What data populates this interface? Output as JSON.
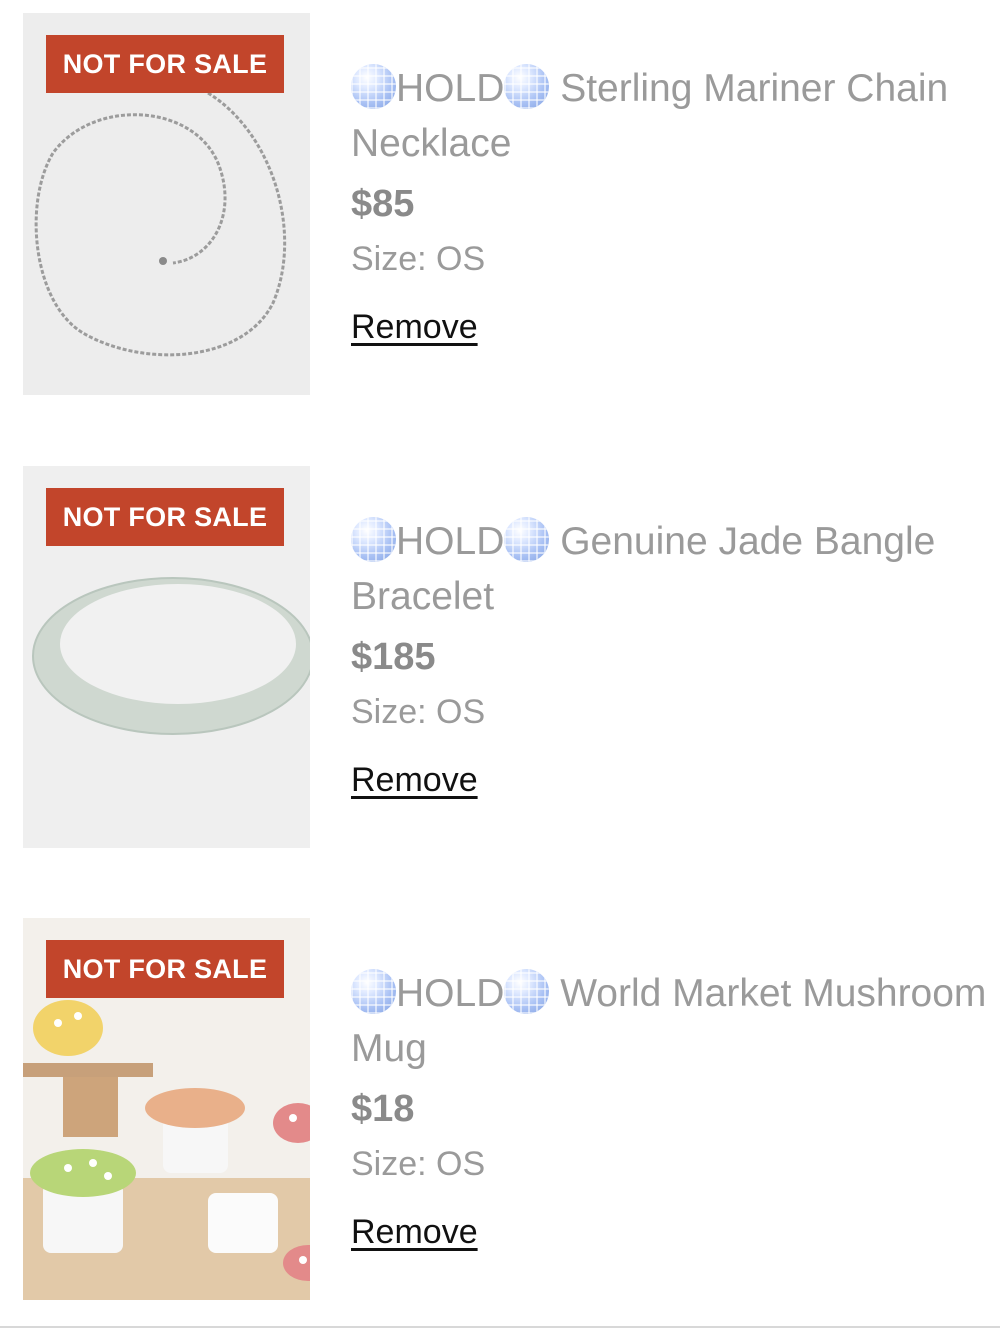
{
  "items": [
    {
      "badge": "NOT FOR SALE",
      "hold_label": "HOLD",
      "title_line1": "Sterling Mariner Chain",
      "title_line2": "Necklace",
      "price": "$85",
      "size": "Size: OS",
      "remove_label": "Remove",
      "image_icon": "chain-necklace-photo"
    },
    {
      "badge": "NOT FOR SALE",
      "hold_label": "HOLD",
      "title_line1": "Genuine Jade Bangle",
      "title_line2": "Bracelet",
      "price": "$185",
      "size": "Size: OS",
      "remove_label": "Remove",
      "image_icon": "jade-bangle-photo"
    },
    {
      "badge": "NOT FOR SALE",
      "hold_label": "HOLD",
      "title_line1": "World Market Mushroom",
      "title_line2": "Mug",
      "price": "$18",
      "size": "Size: OS",
      "remove_label": "Remove",
      "image_icon": "mushroom-mug-photo"
    }
  ],
  "colors": {
    "badge_bg": "#c2452b",
    "badge_text": "#ffffff",
    "muted_text": "#9a9a9a",
    "remove_text": "#111111"
  }
}
